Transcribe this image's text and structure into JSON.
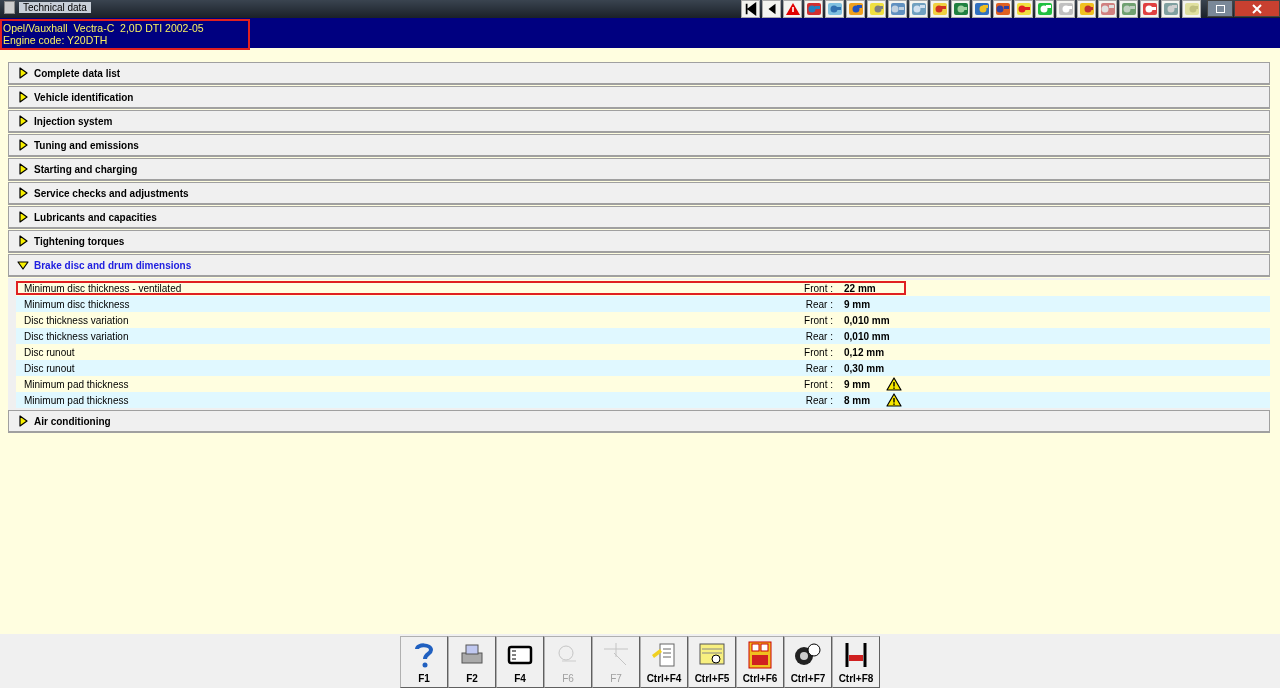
{
  "window": {
    "title": "Technical data"
  },
  "vehicle": {
    "model": "Opel/Vauxhall  Vectra-C  2,0D DTI 2002-05",
    "engine": "Engine code: Y20DTH",
    "annotated": true
  },
  "sections": [
    {
      "title": "Complete data list",
      "expanded": false
    },
    {
      "title": "Vehicle identification",
      "expanded": false
    },
    {
      "title": "Injection system",
      "expanded": false
    },
    {
      "title": "Tuning and emissions",
      "expanded": false
    },
    {
      "title": "Starting and charging",
      "expanded": false
    },
    {
      "title": "Service checks and adjustments",
      "expanded": false
    },
    {
      "title": "Lubricants and capacities",
      "expanded": false
    },
    {
      "title": "Tightening torques",
      "expanded": false
    },
    {
      "title": "Brake disc and drum dimensions",
      "expanded": true,
      "rows": [
        {
          "label": "Minimum disc thickness - ventilated",
          "position": "Front :",
          "value": "22 mm",
          "warning": false,
          "annotated": true
        },
        {
          "label": "Minimum disc thickness",
          "position": "Rear :",
          "value": "9 mm",
          "warning": false,
          "annotated": false
        },
        {
          "label": "Disc thickness variation",
          "position": "Front :",
          "value": "0,010 mm",
          "warning": false,
          "annotated": false
        },
        {
          "label": "Disc thickness variation",
          "position": "Rear :",
          "value": "0,010 mm",
          "warning": false,
          "annotated": false
        },
        {
          "label": "Disc runout",
          "position": "Front :",
          "value": "0,12 mm",
          "warning": false,
          "annotated": false
        },
        {
          "label": "Disc runout",
          "position": "Rear :",
          "value": "0,30 mm",
          "warning": false,
          "annotated": false
        },
        {
          "label": "Minimum pad thickness",
          "position": "Front :",
          "value": "9 mm",
          "warning": true,
          "annotated": false
        },
        {
          "label": "Minimum pad thickness",
          "position": "Rear :",
          "value": "8 mm",
          "warning": true,
          "annotated": false
        }
      ]
    },
    {
      "title": "Air conditioning",
      "expanded": false
    }
  ],
  "function_keys": [
    {
      "label": "F1",
      "disabled": false
    },
    {
      "label": "F2",
      "disabled": false
    },
    {
      "label": "F4",
      "disabled": false
    },
    {
      "label": "F6",
      "disabled": true
    },
    {
      "label": "F7",
      "disabled": true
    },
    {
      "label": "Ctrl+F4",
      "disabled": false
    },
    {
      "label": "Ctrl+F5",
      "disabled": false
    },
    {
      "label": "Ctrl+F6",
      "disabled": false
    },
    {
      "label": "Ctrl+F7",
      "disabled": false
    },
    {
      "label": "Ctrl+F8",
      "disabled": false
    }
  ]
}
